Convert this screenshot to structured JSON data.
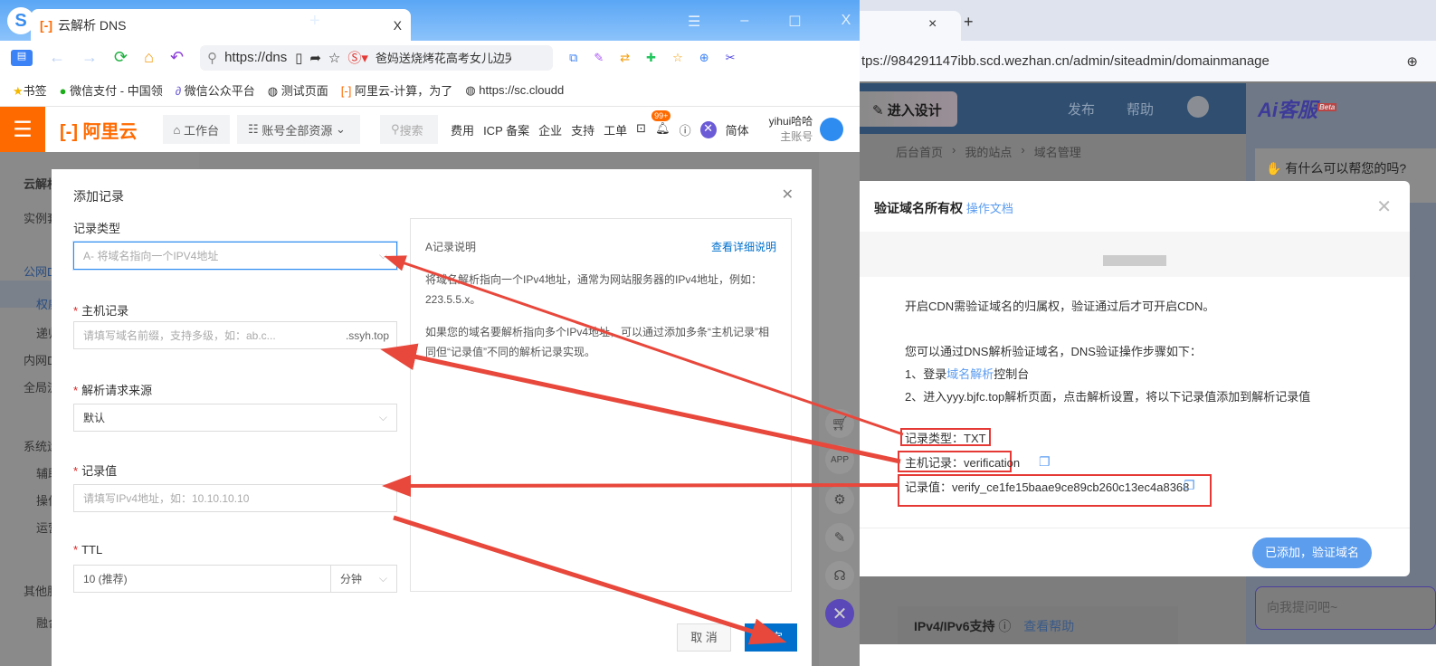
{
  "left_browser": {
    "tab_title": "云解析 DNS",
    "tab_close": "X",
    "new_tab": "+",
    "url": "https://dns",
    "search_text": "爸妈送烧烤花高考女儿边哭",
    "bookmarks": [
      "书签",
      "微信支付 - 中国领",
      "微信公众平台",
      "测试页面",
      "阿里云-计算，为了",
      "https://sc.cloudd"
    ],
    "window_buttons": [
      "☰",
      "–",
      "☐",
      "X"
    ]
  },
  "aliyun_header": {
    "logo": "阿里云",
    "workbench": "工作台",
    "resources": "账号全部资源",
    "search_placeholder": "搜索",
    "nav": [
      "费用",
      "ICP 备案",
      "企业",
      "支持",
      "工单"
    ],
    "badge": "99+",
    "lang": "简体",
    "user": "yihui哈哈",
    "account": "主账号"
  },
  "sidebar": {
    "items": [
      "云解析",
      "实例套",
      "公网D",
      "权威",
      "递归",
      "内网D",
      "全局流",
      "系统运",
      "辅助",
      "操作",
      "运营",
      "其他服",
      "融合"
    ]
  },
  "add_record_modal": {
    "title": "添加记录",
    "record_type_label": "记录类型",
    "record_type_value": "A- 将域名指向一个IPV4地址",
    "host_label": "主机记录",
    "host_placeholder": "请填写域名前缀，支持多级，如：ab.c...",
    "host_suffix": ".ssyh.top",
    "source_label": "解析请求来源",
    "source_value": "默认",
    "value_label": "记录值",
    "value_placeholder": "请填写IPv4地址，如：10.10.10.10",
    "ttl_label": "TTL",
    "ttl_value": "10 (推荐)",
    "ttl_unit": "分钟",
    "info_title": "A记录说明",
    "info_link": "查看详细说明",
    "info_p1": "将域名解析指向一个IPv4地址，通常为网站服务器的IPv4地址，例如：223.5.5.x。",
    "info_p2": "如果您的域名要解析指向多个IPv4地址，可以通过添加多条“主机记录”相同但“记录值”不同的解析记录实现。",
    "cancel": "取 消",
    "confirm": "确定"
  },
  "right_browser": {
    "tab_close": "×",
    "new_tab": "+",
    "url": "tps://984291147ibb.scd.wezhan.cn/admin/siteadmin/domainmanage",
    "design_button": "进入设计",
    "publish": "发布",
    "help": "帮助",
    "breadcrumb": [
      "后台首页",
      "我的站点",
      "域名管理"
    ],
    "ai_title": "Ai客服",
    "ai_beta": "Beta",
    "ai_greeting": "有什么可以帮您的吗?",
    "ai_input_placeholder": "向我提问吧~",
    "ipv_title": "IPv4/IPv6支持",
    "ipv_help": "查看帮助"
  },
  "verify_dialog": {
    "title": "验证域名所有权",
    "doc_link": "操作文档",
    "p1": "开启CDN需验证域名的归属权，验证通过后才可开启CDN。",
    "p2": "您可以通过DNS解析验证域名，DNS验证操作步骤如下：",
    "step1_prefix": "1、登录",
    "step1_link": "域名解析",
    "step1_suffix": "控制台",
    "step2": "2、进入yyy.bjfc.top解析页面，点击解析设置，将以下记录值添加到解析记录值",
    "record_type": "记录类型：TXT",
    "host": "主机记录：verification",
    "value": "记录值：verify_ce1fe15baae9ce89cb260c13ec4a8368",
    "submit": "已添加，验证域名"
  },
  "colors": {
    "aliyun_orange": "#ff6a00",
    "primary_blue": "#0070cc",
    "arrow_red": "#e8473b",
    "verify_button": "#5c9ded"
  }
}
